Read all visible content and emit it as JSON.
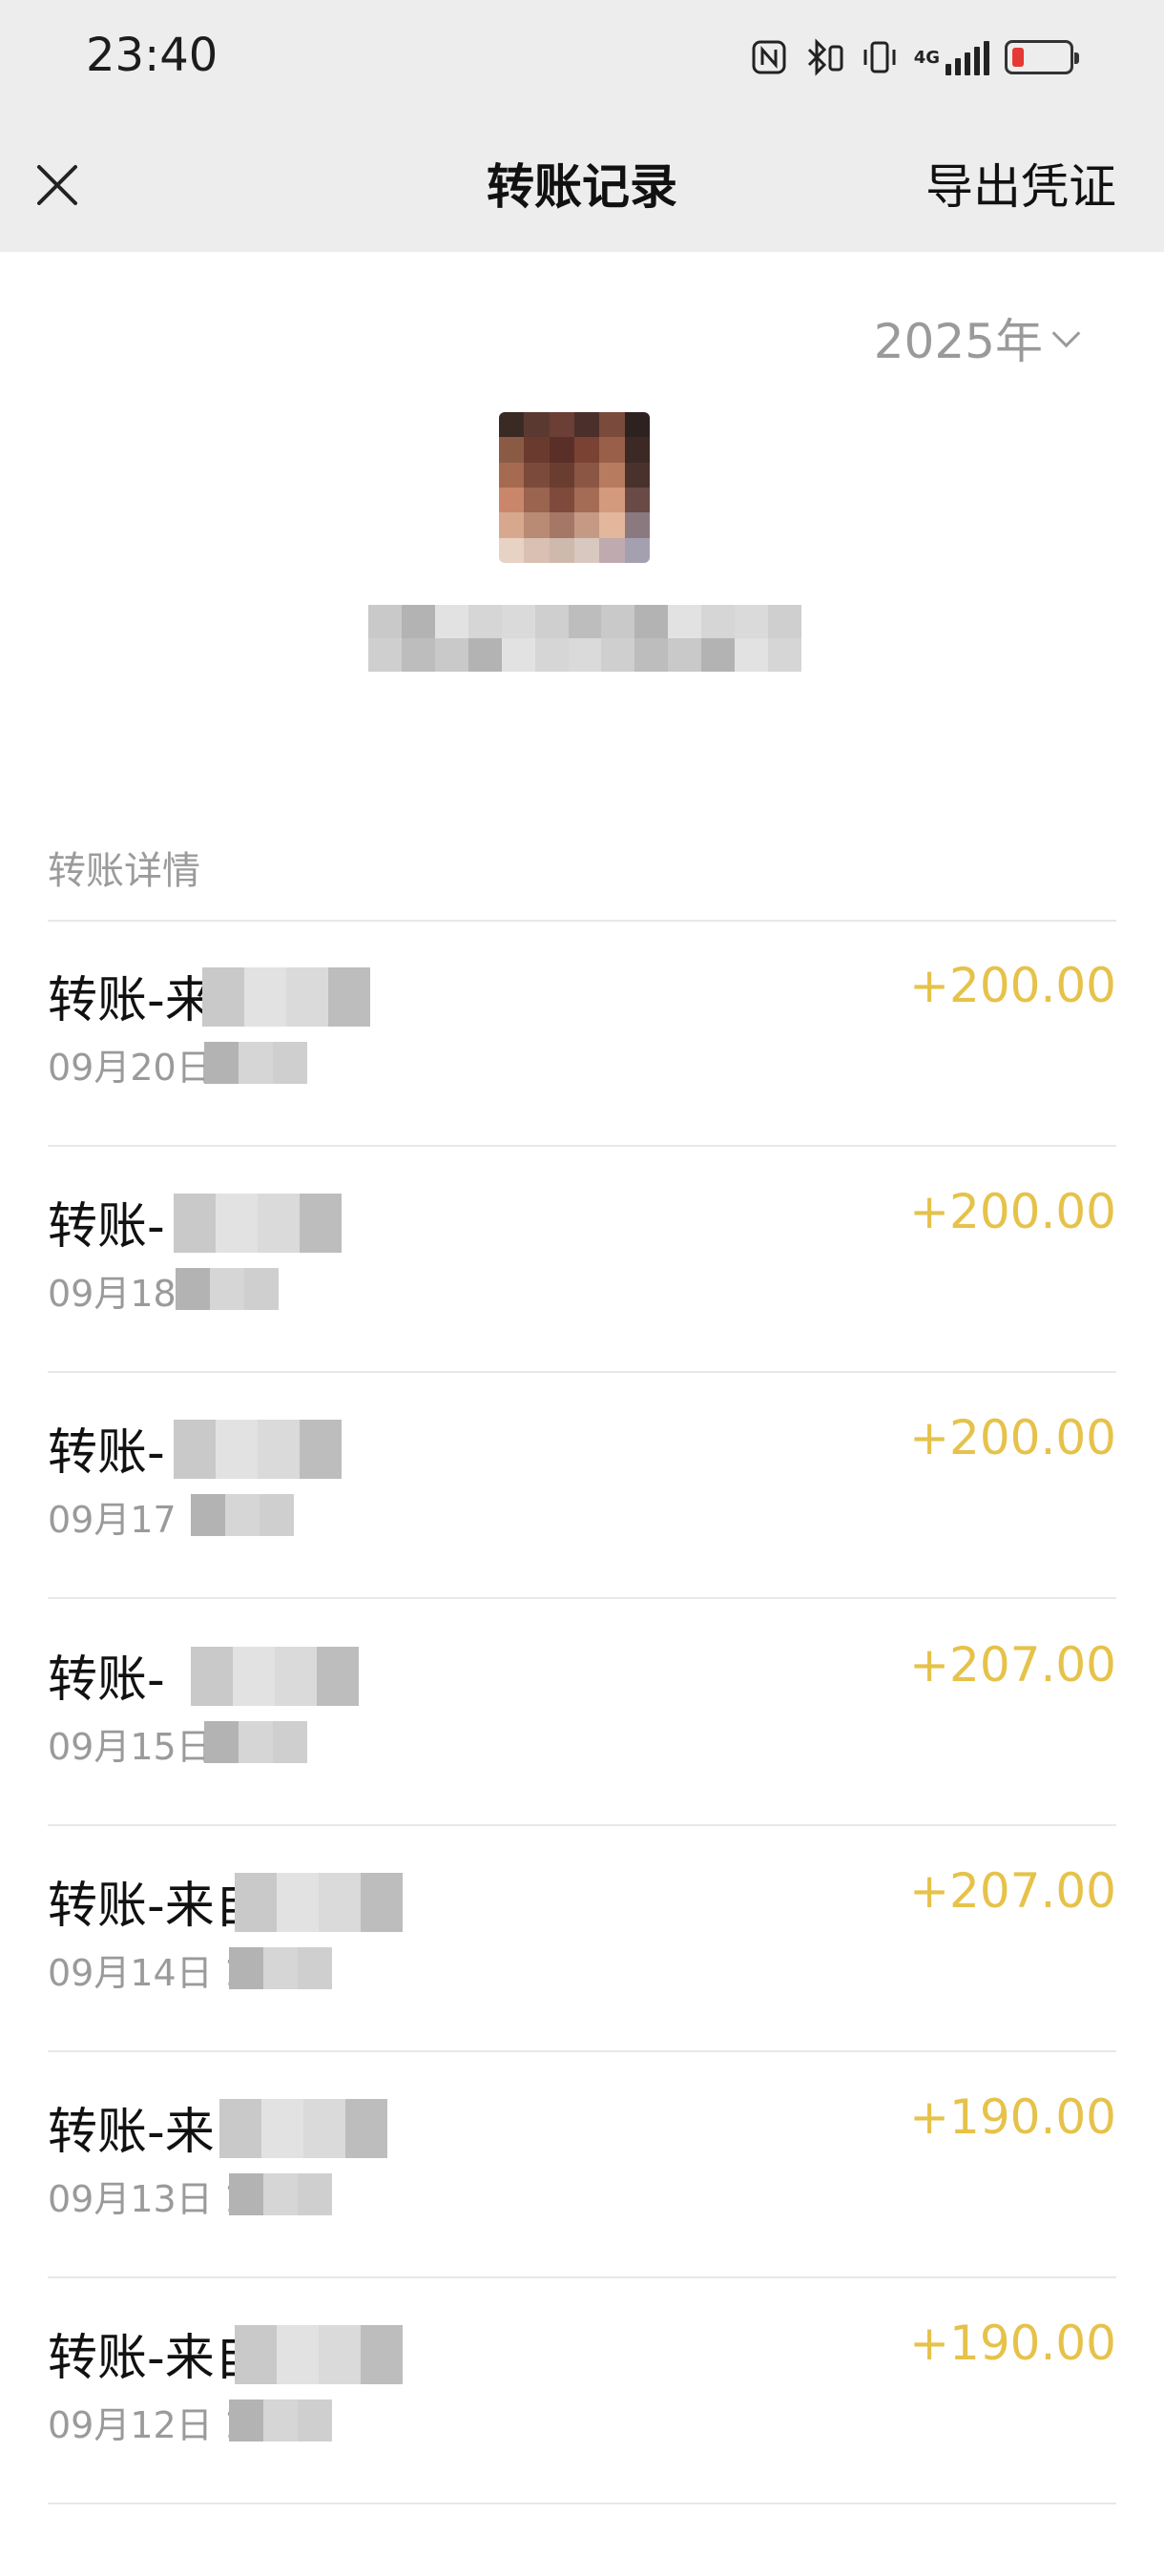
{
  "status_bar": {
    "time": "23:40",
    "icons": [
      "nfc-icon",
      "bluetooth-icon",
      "vibrate-icon",
      "4g-signal-icon",
      "battery-low-icon"
    ],
    "network_label": "4G"
  },
  "nav": {
    "title": "转账记录",
    "export_label": "导出凭证",
    "close_icon": "close-icon"
  },
  "year_filter": {
    "value": "2025年"
  },
  "section": {
    "label": "转账详情"
  },
  "colors": {
    "amount": "#e6c24a",
    "battery_low": "#e53935"
  },
  "transactions": [
    {
      "title": "转账-来",
      "date": "09月20日",
      "amount": "+200.00"
    },
    {
      "title": "转账-",
      "date": "09月18",
      "amount": "+200.00"
    },
    {
      "title": "转账-",
      "date": "09月17",
      "amount": "+200.00"
    },
    {
      "title": "转账-",
      "date": "09月15日",
      "amount": "+207.00"
    },
    {
      "title": "转账-来自",
      "date": "09月14日 1",
      "amount": "+207.00"
    },
    {
      "title": "转账-来",
      "date": "09月13日 1",
      "amount": "+190.00"
    },
    {
      "title": "转账-来自",
      "date": "09月12日 1",
      "amount": "+190.00"
    }
  ]
}
